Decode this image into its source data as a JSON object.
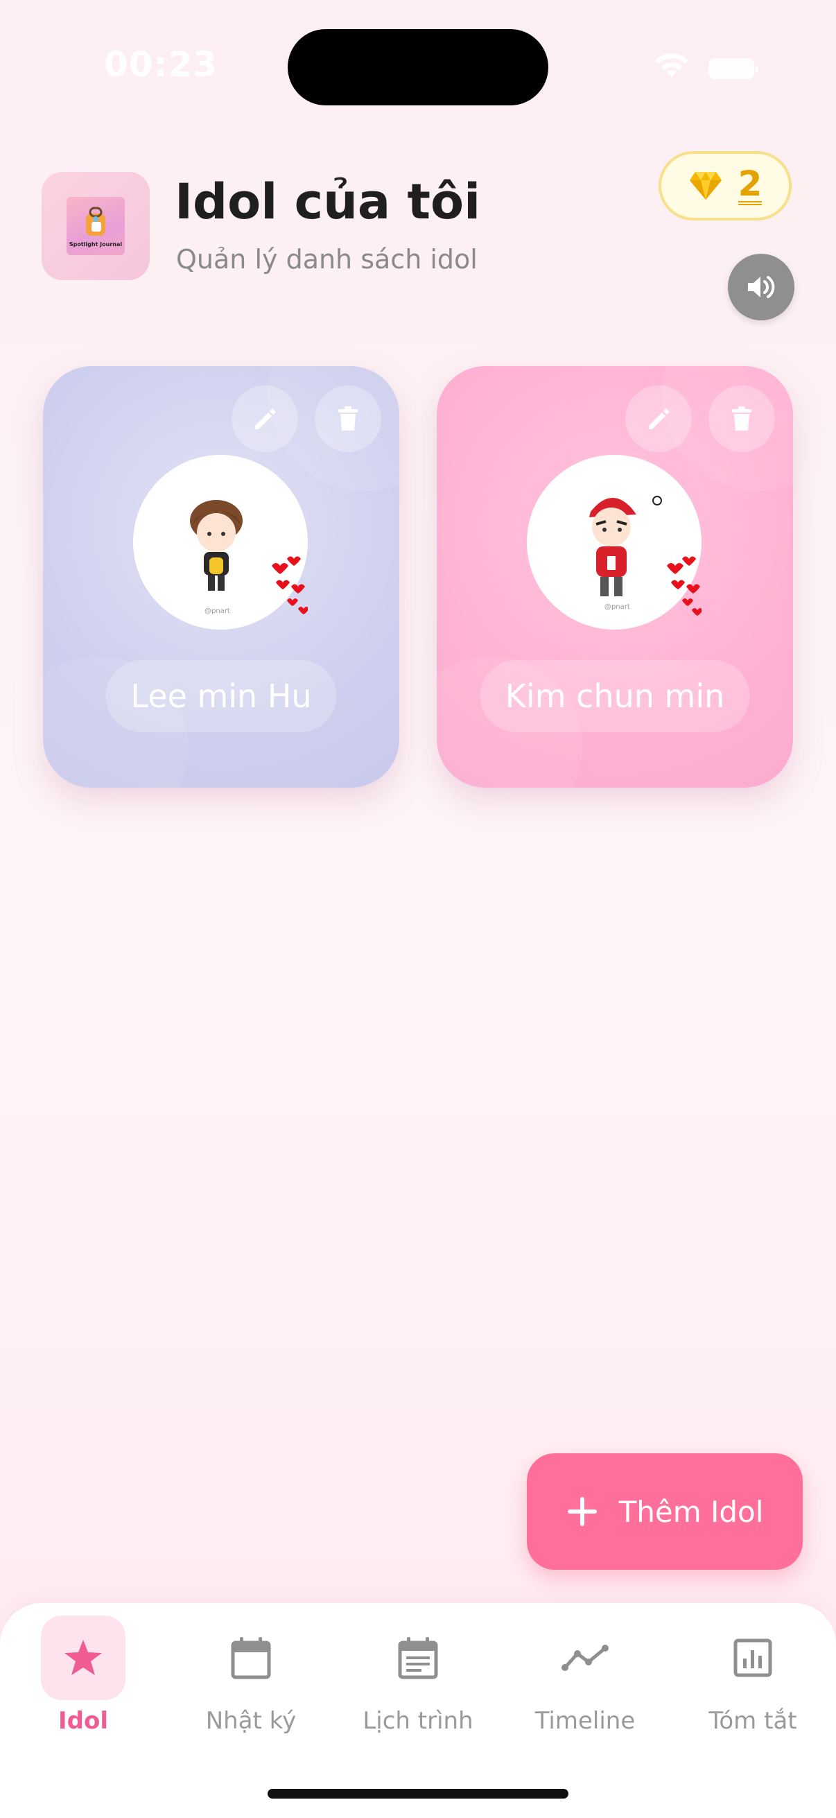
{
  "status_bar": {
    "time": "00:23"
  },
  "header": {
    "title": "Idol của tôi",
    "subtitle": "Quản lý danh sách idol",
    "logo_text": "Spotlight Journal"
  },
  "gems": {
    "count": "2"
  },
  "idols": [
    {
      "name": "Lee min Hu",
      "card_color": "#cfd0ee"
    },
    {
      "name": "Kim chun min",
      "card_color": "#ffb2d3"
    }
  ],
  "add_button": {
    "label": "Thêm Idol"
  },
  "nav": {
    "items": [
      {
        "label": "Idol",
        "icon": "star-icon",
        "active": true
      },
      {
        "label": "Nhật ký",
        "icon": "calendar-icon",
        "active": false
      },
      {
        "label": "Lịch trình",
        "icon": "schedule-icon",
        "active": false
      },
      {
        "label": "Timeline",
        "icon": "timeline-icon",
        "active": false
      },
      {
        "label": "Tóm tắt",
        "icon": "summary-chart-icon",
        "active": false
      }
    ]
  },
  "colors": {
    "accent": "#ff6f9c",
    "active_nav": "#ef5b92",
    "gem": "#e2a300"
  }
}
